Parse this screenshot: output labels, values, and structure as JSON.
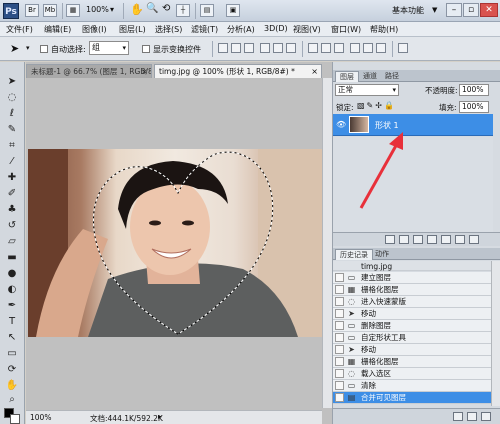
{
  "titlebar": {
    "logo": "Ps",
    "zoom": "100%",
    "workspace": "基本功能",
    "workspace_arrow": "▼"
  },
  "menu": [
    "文件(F)",
    "编辑(E)",
    "图像(I)",
    "图层(L)",
    "选择(S)",
    "滤镜(T)",
    "分析(A)",
    "3D(D)",
    "视图(V)",
    "窗口(W)",
    "帮助(H)"
  ],
  "options": {
    "auto_select": "自动选择:",
    "auto_select_value": "组",
    "show_transform": "显示变换控件"
  },
  "document": {
    "tabs": [
      {
        "label": "未标题-1 @ 66.7% (图层 1, RGB/8)",
        "close": "×",
        "active": false
      },
      {
        "label": "timg.jpg @ 100% (形状 1, RGB/8#) *",
        "close": "×",
        "active": true
      }
    ],
    "zoom": "100%",
    "doc_info": "文档:444.1K/592.2K"
  },
  "layers_panel": {
    "tabs": [
      "图层",
      "通道",
      "路径"
    ],
    "blend_mode": "正常",
    "opacity_label": "不透明度:",
    "opacity": "100%",
    "lock_label": "锁定:",
    "fill_label": "填充:",
    "fill": "100%",
    "layer_name": "形状 1"
  },
  "history_panel": {
    "tabs": [
      "历史记录",
      "动作"
    ],
    "snapshot": "timg.jpg",
    "items": [
      "建立图层",
      "栅格化图层",
      "进入快速蒙版",
      "移动",
      "删除图层",
      "自定形状工具",
      "移动",
      "栅格化图层",
      "载入选区",
      "清除",
      "合并可见图层"
    ]
  },
  "colors": {
    "selection_blue": "#3d8ee6",
    "arrow_red": "#e8303a"
  }
}
